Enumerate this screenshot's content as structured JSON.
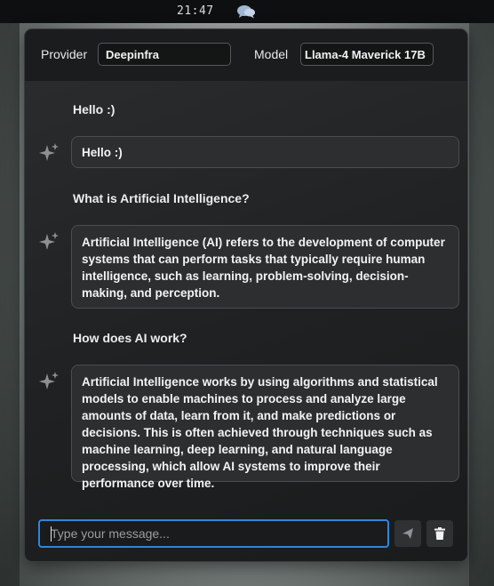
{
  "topbar": {
    "clock": "21:47",
    "chat_icon": "chat-bubbles-icon"
  },
  "header": {
    "provider_label": "Provider",
    "provider_value": "Deepinfra",
    "model_label": "Model",
    "model_value": "Llama-4 Maverick 17B"
  },
  "messages": [
    {
      "role": "user",
      "text": "Hello :)"
    },
    {
      "role": "assistant",
      "text": "Hello :)"
    },
    {
      "role": "user",
      "text": "What is Artificial Intelligence?"
    },
    {
      "role": "assistant",
      "text": "Artificial Intelligence (AI) refers to the development of computer systems that can perform tasks that typically require human intelligence, such as learning, problem-solving, decision-making, and perception."
    },
    {
      "role": "user",
      "text": "How does AI work?"
    },
    {
      "role": "assistant",
      "text": "Artificial Intelligence works by using algorithms and statistical models to enable machines to process and analyze large amounts of data, learn from it, and make predictions or decisions. This is often achieved through techniques such as machine learning, deep learning, and natural language processing, which allow AI systems to improve their performance over time."
    }
  ],
  "composer": {
    "placeholder": "Type your message...",
    "send_icon": "send-icon",
    "clear_icon": "trash-icon"
  },
  "colors": {
    "accent": "#2f86d8"
  }
}
